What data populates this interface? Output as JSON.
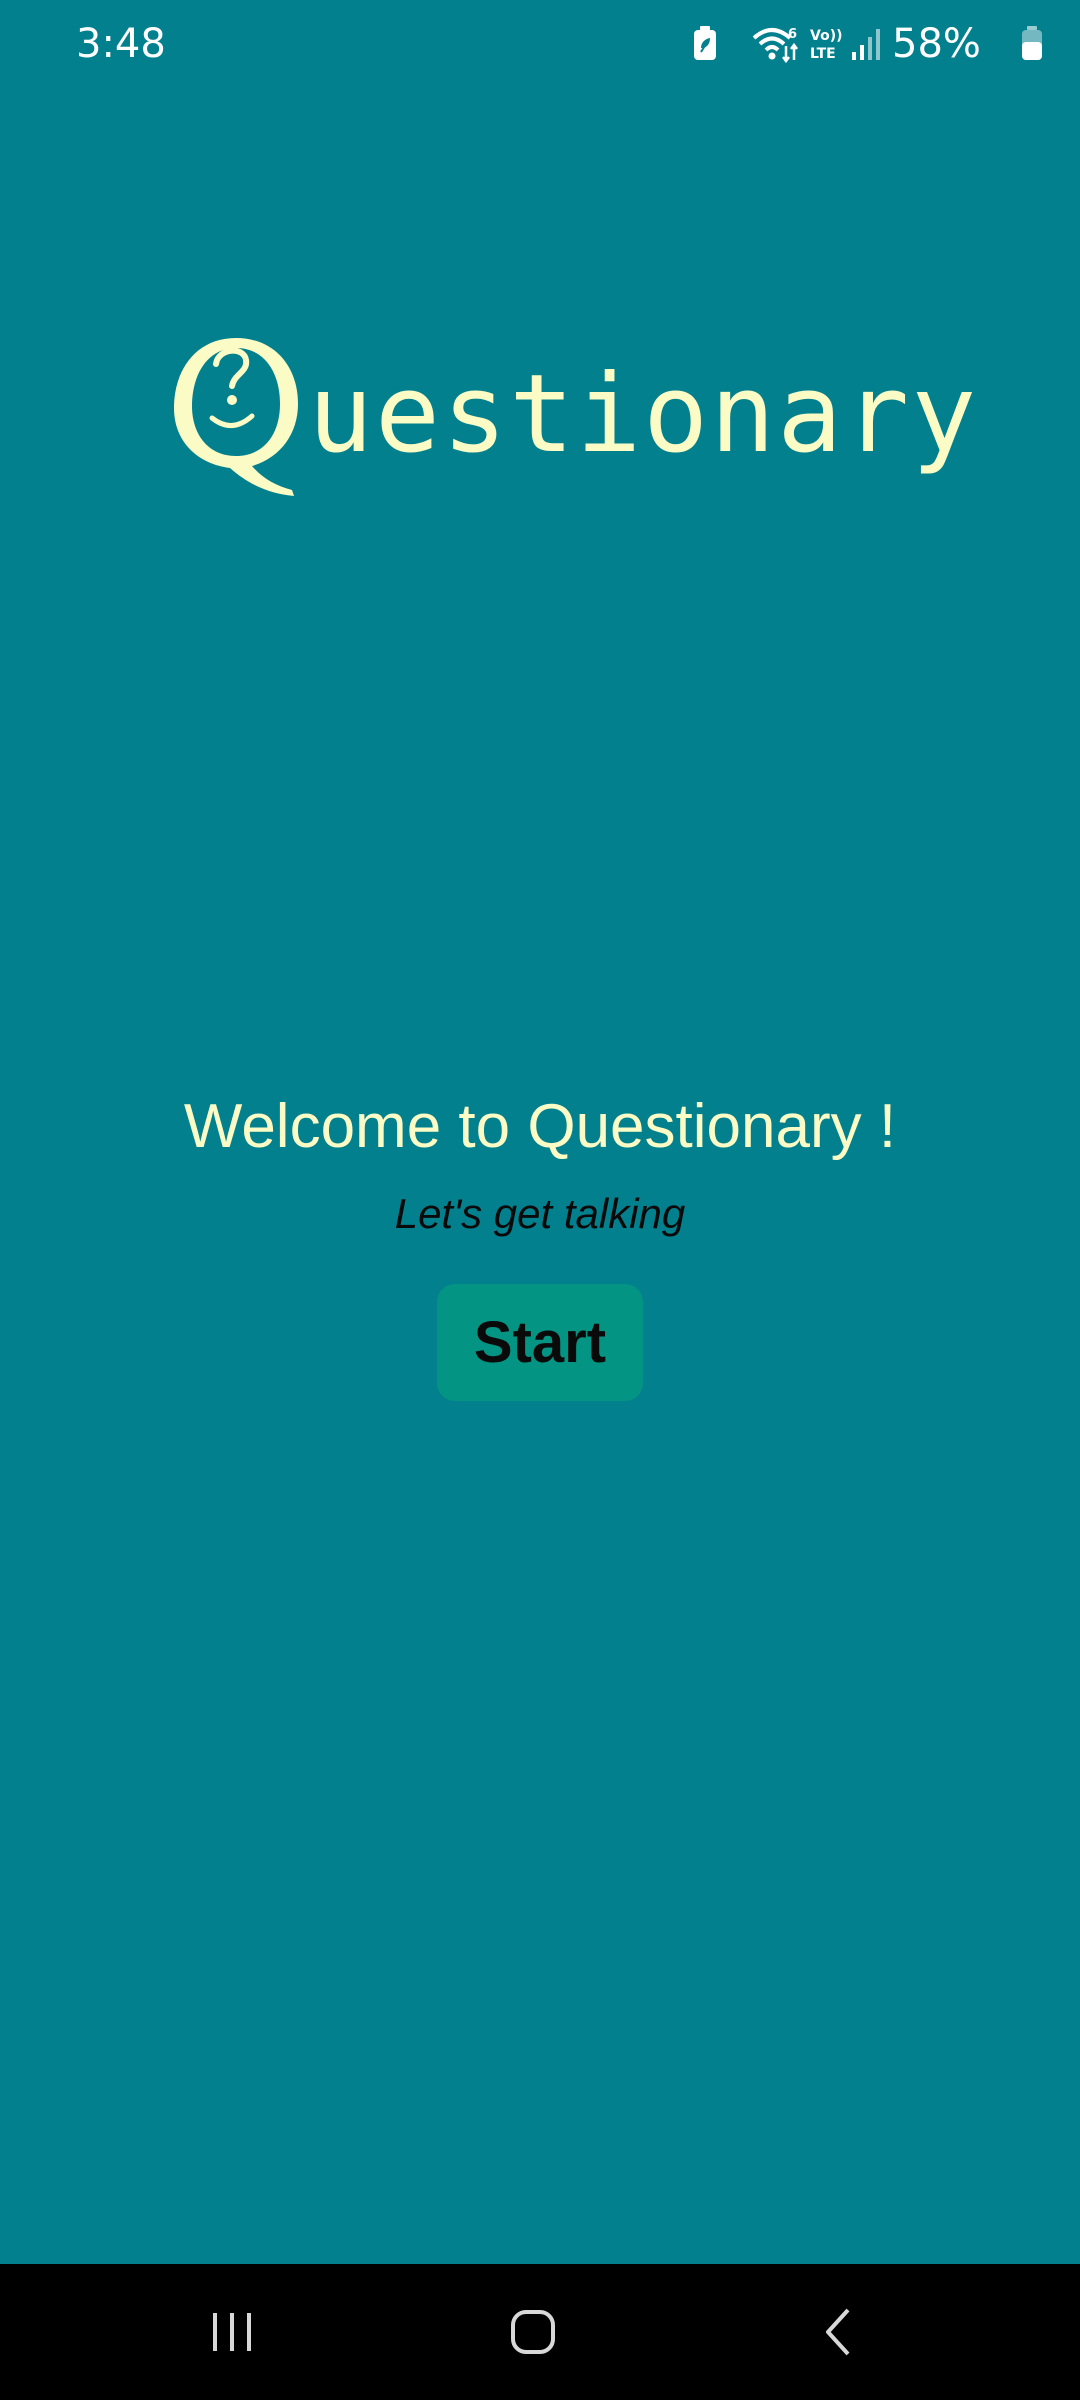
{
  "status_bar": {
    "time": "3:48",
    "battery_percent": "58%",
    "icons": [
      "battery-saver-icon",
      "wifi-icon",
      "volte-icon",
      "signal-icon",
      "battery-icon"
    ],
    "battery_level": 0.58
  },
  "logo": {
    "initial": "Q",
    "rest": "uestionary"
  },
  "welcome": {
    "title": "Welcome to Questionary !",
    "subtitle": "Let's get talking",
    "start_label": "Start"
  },
  "nav_bar": {
    "icons": [
      "recents-icon",
      "home-icon",
      "back-icon"
    ]
  },
  "colors": {
    "background": "#03808E",
    "accent_text": "#FBFBC5",
    "button": "#039483",
    "nav_bar": "#000000"
  }
}
